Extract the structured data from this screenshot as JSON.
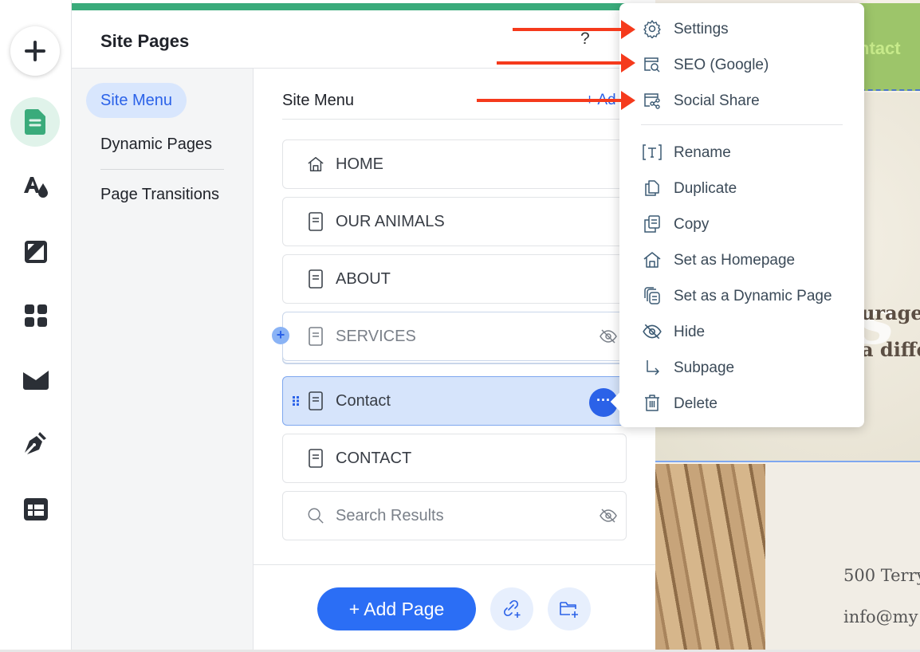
{
  "rail": {
    "items": [
      {
        "name": "add-elements",
        "icon": "plus-icon"
      },
      {
        "name": "pages",
        "icon": "page-icon",
        "active": true
      },
      {
        "name": "site-design",
        "icon": "theme-icon"
      },
      {
        "name": "background",
        "icon": "background-icon"
      },
      {
        "name": "apps",
        "icon": "apps-grid-icon"
      },
      {
        "name": "media",
        "icon": "media-icon"
      },
      {
        "name": "blog",
        "icon": "pen-icon"
      },
      {
        "name": "cms",
        "icon": "table-icon"
      }
    ]
  },
  "panel": {
    "title": "Site Pages",
    "help": "?",
    "subnav": [
      {
        "label": "Site Menu",
        "active": true
      },
      {
        "label": "Dynamic Pages"
      },
      {
        "label": "Page Transitions"
      }
    ],
    "menu_title": "Site Menu",
    "add_link": "+ Ad",
    "pages": [
      {
        "label": "HOME",
        "icon": "home-icon",
        "state": "normal"
      },
      {
        "label": "OUR ANIMALS",
        "icon": "page-icon",
        "state": "normal"
      },
      {
        "label": "ABOUT",
        "icon": "page-icon",
        "state": "normal"
      },
      {
        "label": "SERVICES",
        "icon": "page-icon",
        "state": "hidden",
        "dragging": true
      },
      {
        "label": "Contact",
        "icon": "page-icon",
        "state": "selected"
      },
      {
        "label": "CONTACT",
        "icon": "page-icon",
        "state": "normal"
      },
      {
        "label": "Search Results",
        "icon": "search-icon",
        "state": "hidden"
      }
    ],
    "more_label": "···",
    "add_page_label": "+ Add Page"
  },
  "context_menu": {
    "items": [
      {
        "label": "Settings",
        "icon": "gear-icon",
        "highlighted": true
      },
      {
        "label": "SEO (Google)",
        "icon": "seo-search-icon",
        "highlighted": true
      },
      {
        "label": "Social Share",
        "icon": "social-share-icon",
        "highlighted": true
      },
      {
        "label": "Rename",
        "icon": "rename-icon"
      },
      {
        "label": "Duplicate",
        "icon": "duplicate-icon"
      },
      {
        "label": "Copy",
        "icon": "copy-icon"
      },
      {
        "label": "Set as Homepage",
        "icon": "home-icon"
      },
      {
        "label": "Set as a Dynamic Page",
        "icon": "dynamic-page-icon"
      },
      {
        "label": "Hide",
        "icon": "eye-off-icon"
      },
      {
        "label": "Subpage",
        "icon": "subpage-arrow-icon"
      },
      {
        "label": "Delete",
        "icon": "trash-icon"
      }
    ]
  },
  "canvas": {
    "nav_text": "ntact",
    "hero_script": "s",
    "hero_line1": "urage",
    "hero_line2": "a diffe",
    "footer_line1": "500 Terry",
    "footer_line2": "info@my"
  },
  "colors": {
    "accent_blue": "#2b62e8",
    "pages_green": "#3aab7b",
    "annotation_red": "#f53a1c"
  }
}
